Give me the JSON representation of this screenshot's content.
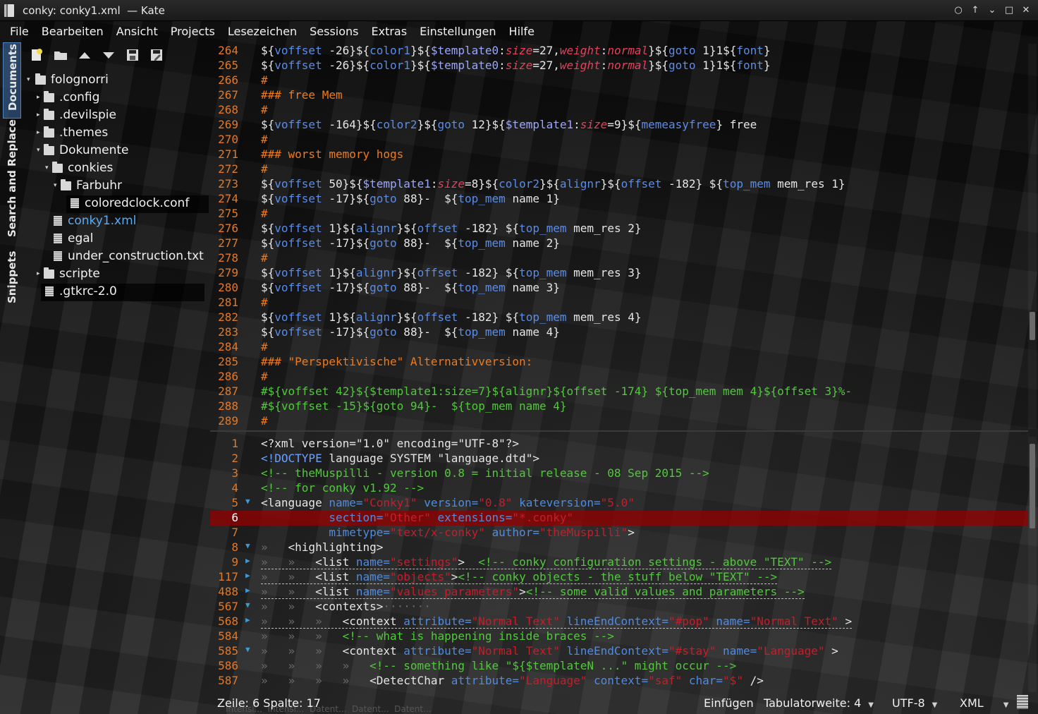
{
  "window": {
    "title": "conky: conky1.xml  — Kate",
    "buttons": [
      "○",
      "↑",
      "⌄",
      "□",
      "✕"
    ]
  },
  "menu": [
    {
      "label": "File"
    },
    {
      "label": "Bearbeiten"
    },
    {
      "label": "Ansicht"
    },
    {
      "label": "Projects"
    },
    {
      "label": "Lesezeichen"
    },
    {
      "label": "Sessions"
    },
    {
      "label": "Extras"
    },
    {
      "label": "Einstellungen"
    },
    {
      "label": "Hilfe"
    }
  ],
  "side_tabs": {
    "documents": "Documents",
    "search": "Search and Replace",
    "snippets": "Snippets"
  },
  "file_tree": [
    {
      "label": "folognorri",
      "type": "folder",
      "depth": 0,
      "arrow": "▾"
    },
    {
      "label": ".config",
      "type": "folder",
      "depth": 1,
      "arrow": "▸"
    },
    {
      "label": ".devilspie",
      "type": "folder",
      "depth": 1,
      "arrow": "▸"
    },
    {
      "label": ".themes",
      "type": "folder",
      "depth": 1,
      "arrow": "▸"
    },
    {
      "label": "Dokumente",
      "type": "folder",
      "depth": 1,
      "arrow": "▾"
    },
    {
      "label": "conkies",
      "type": "folder",
      "depth": 2,
      "arrow": "▾"
    },
    {
      "label": "Farbuhr",
      "type": "folder",
      "depth": 3,
      "arrow": "▾"
    },
    {
      "label": "coloredclock.conf",
      "type": "file",
      "depth": 4,
      "arrow": ""
    },
    {
      "label": "conky1.xml",
      "type": "file",
      "depth": 3,
      "arrow": "",
      "current": true
    },
    {
      "label": "egal",
      "type": "file",
      "depth": 3,
      "arrow": ""
    },
    {
      "label": "under_construction.txt",
      "type": "file",
      "depth": 3,
      "arrow": ""
    },
    {
      "label": "scripte",
      "type": "folder",
      "depth": 1,
      "arrow": "▸"
    },
    {
      "label": ".gtkrc-2.0",
      "type": "file",
      "depth": 1,
      "arrow": ""
    }
  ],
  "top_view": {
    "lines": [
      {
        "n": "264",
        "segs": [
          [
            "${",
            "def"
          ],
          [
            "voffset",
            "var"
          ],
          [
            " -26}${",
            "def"
          ],
          [
            "color1",
            "var"
          ],
          [
            "}${",
            "def"
          ],
          [
            "$template0",
            "tpl"
          ],
          [
            ":",
            "def"
          ],
          [
            "size",
            "kw"
          ],
          [
            "=27,",
            "def"
          ],
          [
            "weight",
            "kw"
          ],
          [
            ":",
            "def"
          ],
          [
            "normal",
            "kw"
          ],
          [
            "}${",
            "def"
          ],
          [
            "goto",
            "var"
          ],
          [
            " 1}1${",
            "def"
          ],
          [
            "font",
            "var"
          ],
          [
            "}",
            "def"
          ]
        ]
      },
      {
        "n": "265",
        "segs": [
          [
            "${",
            "def"
          ],
          [
            "voffset",
            "var"
          ],
          [
            " -26}${",
            "def"
          ],
          [
            "color1",
            "var"
          ],
          [
            "}${",
            "def"
          ],
          [
            "$template0",
            "tpl"
          ],
          [
            ":",
            "def"
          ],
          [
            "size",
            "kw"
          ],
          [
            "=27,",
            "def"
          ],
          [
            "weight",
            "kw"
          ],
          [
            ":",
            "def"
          ],
          [
            "normal",
            "kw"
          ],
          [
            "}${",
            "def"
          ],
          [
            "goto",
            "var"
          ],
          [
            " 1}1${",
            "def"
          ],
          [
            "font",
            "var"
          ],
          [
            "}",
            "def"
          ]
        ]
      },
      {
        "n": "266",
        "segs": [
          [
            "#",
            "com"
          ]
        ]
      },
      {
        "n": "267",
        "segs": [
          [
            "### free Mem",
            "com"
          ]
        ]
      },
      {
        "n": "268",
        "segs": [
          [
            "#",
            "com"
          ]
        ]
      },
      {
        "n": "269",
        "segs": [
          [
            "${",
            "def"
          ],
          [
            "voffset",
            "var"
          ],
          [
            " -164}${",
            "def"
          ],
          [
            "color2",
            "var"
          ],
          [
            "}${",
            "def"
          ],
          [
            "goto",
            "var"
          ],
          [
            " 12}${",
            "def"
          ],
          [
            "$template1",
            "tpl"
          ],
          [
            ":",
            "def"
          ],
          [
            "size",
            "kw"
          ],
          [
            "=9}${",
            "def"
          ],
          [
            "memeasyfree",
            "var"
          ],
          [
            "} free",
            "def"
          ]
        ]
      },
      {
        "n": "270",
        "segs": [
          [
            "#",
            "com"
          ]
        ]
      },
      {
        "n": "271",
        "segs": [
          [
            "### worst memory hogs",
            "com"
          ]
        ]
      },
      {
        "n": "272",
        "segs": [
          [
            "#",
            "com"
          ]
        ]
      },
      {
        "n": "273",
        "segs": [
          [
            "${",
            "def"
          ],
          [
            "voffset",
            "var"
          ],
          [
            " 50}${",
            "def"
          ],
          [
            "$template1",
            "tpl"
          ],
          [
            ":",
            "def"
          ],
          [
            "size",
            "kw"
          ],
          [
            "=8}${",
            "def"
          ],
          [
            "color2",
            "var"
          ],
          [
            "}${",
            "def"
          ],
          [
            "alignr",
            "var"
          ],
          [
            "}${",
            "def"
          ],
          [
            "offset",
            "var"
          ],
          [
            " -182} ${",
            "def"
          ],
          [
            "top_mem",
            "var"
          ],
          [
            " mem_res 1}",
            "def"
          ]
        ]
      },
      {
        "n": "274",
        "segs": [
          [
            "${",
            "def"
          ],
          [
            "voffset",
            "var"
          ],
          [
            " -17}${",
            "def"
          ],
          [
            "goto",
            "var"
          ],
          [
            " 88}-  ${",
            "def"
          ],
          [
            "top_mem",
            "var"
          ],
          [
            " name 1}",
            "def"
          ]
        ]
      },
      {
        "n": "275",
        "segs": [
          [
            "#",
            "com"
          ]
        ]
      },
      {
        "n": "276",
        "segs": [
          [
            "${",
            "def"
          ],
          [
            "voffset",
            "var"
          ],
          [
            " 1}${",
            "def"
          ],
          [
            "alignr",
            "var"
          ],
          [
            "}${",
            "def"
          ],
          [
            "offset",
            "var"
          ],
          [
            " -182} ${",
            "def"
          ],
          [
            "top_mem",
            "var"
          ],
          [
            " mem_res 2}",
            "def"
          ]
        ]
      },
      {
        "n": "277",
        "segs": [
          [
            "${",
            "def"
          ],
          [
            "voffset",
            "var"
          ],
          [
            " -17}${",
            "def"
          ],
          [
            "goto",
            "var"
          ],
          [
            " 88}-  ${",
            "def"
          ],
          [
            "top_mem",
            "var"
          ],
          [
            " name 2}",
            "def"
          ]
        ]
      },
      {
        "n": "278",
        "segs": [
          [
            "#",
            "com"
          ]
        ]
      },
      {
        "n": "279",
        "segs": [
          [
            "${",
            "def"
          ],
          [
            "voffset",
            "var"
          ],
          [
            " 1}${",
            "def"
          ],
          [
            "alignr",
            "var"
          ],
          [
            "}${",
            "def"
          ],
          [
            "offset",
            "var"
          ],
          [
            " -182} ${",
            "def"
          ],
          [
            "top_mem",
            "var"
          ],
          [
            " mem_res 3}",
            "def"
          ]
        ]
      },
      {
        "n": "280",
        "segs": [
          [
            "${",
            "def"
          ],
          [
            "voffset",
            "var"
          ],
          [
            " -17}${",
            "def"
          ],
          [
            "goto",
            "var"
          ],
          [
            " 88}-  ${",
            "def"
          ],
          [
            "top_mem",
            "var"
          ],
          [
            " name 3}",
            "def"
          ]
        ]
      },
      {
        "n": "281",
        "segs": [
          [
            "#",
            "com"
          ]
        ]
      },
      {
        "n": "282",
        "segs": [
          [
            "${",
            "def"
          ],
          [
            "voffset",
            "var"
          ],
          [
            " 1}${",
            "def"
          ],
          [
            "alignr",
            "var"
          ],
          [
            "}${",
            "def"
          ],
          [
            "offset",
            "var"
          ],
          [
            " -182} ${",
            "def"
          ],
          [
            "top_mem",
            "var"
          ],
          [
            " mem_res 4}",
            "def"
          ]
        ]
      },
      {
        "n": "283",
        "segs": [
          [
            "${",
            "def"
          ],
          [
            "voffset",
            "var"
          ],
          [
            " -17}${",
            "def"
          ],
          [
            "goto",
            "var"
          ],
          [
            " 88}-  ${",
            "def"
          ],
          [
            "top_mem",
            "var"
          ],
          [
            " name 4}",
            "def"
          ]
        ]
      },
      {
        "n": "284",
        "segs": [
          [
            "#",
            "com"
          ]
        ]
      },
      {
        "n": "285",
        "segs": [
          [
            "### \"Perspektivische\" Alternativversion:",
            "com"
          ]
        ]
      },
      {
        "n": "286",
        "segs": [
          [
            "#",
            "com"
          ]
        ]
      },
      {
        "n": "287",
        "segs": [
          [
            "#${voffset 42}${$template1:size=7}${alignr}${offset -174} ${top_mem mem 4}${offset 3}%-",
            "grn"
          ]
        ]
      },
      {
        "n": "288",
        "segs": [
          [
            "#${voffset -15}${goto 94}-  ${top_mem name 4}",
            "grn"
          ]
        ]
      },
      {
        "n": "289",
        "segs": [
          [
            "#",
            "com"
          ]
        ]
      }
    ]
  },
  "bottom_view": {
    "lines": [
      {
        "n": "1",
        "fold": "",
        "segs": [
          [
            "<?xml version=\"1.0\" encoding=\"UTF-8\"?>",
            "def"
          ]
        ]
      },
      {
        "n": "2",
        "fold": "",
        "segs": [
          [
            "<!DOCTYPE",
            "blu"
          ],
          [
            " language SYSTEM \"language.dtd\">",
            "def"
          ]
        ]
      },
      {
        "n": "3",
        "fold": "",
        "segs": [
          [
            "<!-- theMuspilli - version 0.8 = initial release - 08 Sep 2015 -->",
            "grn"
          ]
        ]
      },
      {
        "n": "4",
        "fold": "",
        "segs": [
          [
            "<!-- for conky v1.92 -->",
            "grn"
          ]
        ]
      },
      {
        "n": "5",
        "fold": "▼",
        "segs": [
          [
            "<language ",
            "def"
          ],
          [
            "name=",
            "attr"
          ],
          [
            "\"Conky1\"",
            "str"
          ],
          [
            " version=",
            "attr"
          ],
          [
            "\"0.8\"",
            "str"
          ],
          [
            " kateversion=",
            "attr"
          ],
          [
            "\"5.0\"",
            "str"
          ]
        ]
      },
      {
        "n": "6",
        "fold": "",
        "current": true,
        "segs": [
          [
            "          section=",
            "attr"
          ],
          [
            "\"Other\"",
            "str"
          ],
          [
            " extensions=",
            "attr"
          ],
          [
            "\"*.conky\"",
            "str"
          ]
        ]
      },
      {
        "n": "7",
        "fold": "",
        "segs": [
          [
            "          mimetype=",
            "attr"
          ],
          [
            "\"text/x-conky\"",
            "str"
          ],
          [
            " author=",
            "attr"
          ],
          [
            "\"theMuspilli\"",
            "str"
          ],
          [
            ">",
            "def"
          ]
        ]
      },
      {
        "n": "8",
        "fold": "▼",
        "segs": [
          [
            "»   ",
            "gry"
          ],
          [
            "<highlighting>",
            "def"
          ]
        ]
      },
      {
        "n": "9",
        "fold": "▶",
        "dotted": true,
        "segs": [
          [
            "»   »   ",
            "gry"
          ],
          [
            "<list ",
            "def"
          ],
          [
            "name=",
            "attr"
          ],
          [
            "\"settings\"",
            "str"
          ],
          [
            ">  ",
            "def"
          ],
          [
            "<!-- conky configuration settings - above \"TEXT\" -->",
            "grn"
          ]
        ]
      },
      {
        "n": "117",
        "fold": "▶",
        "dotted": true,
        "segs": [
          [
            "»   »   ",
            "gry"
          ],
          [
            "<list ",
            "def"
          ],
          [
            "name=",
            "attr"
          ],
          [
            "\"objects\"",
            "str"
          ],
          [
            ">",
            "def"
          ],
          [
            "<!-- conky objects - the stuff below \"TEXT\" -->",
            "grn"
          ]
        ]
      },
      {
        "n": "488",
        "fold": "▶",
        "dotted": true,
        "segs": [
          [
            "»   »   ",
            "gry"
          ],
          [
            "<list ",
            "def"
          ],
          [
            "name=",
            "attr"
          ],
          [
            "\"values_parameters\"",
            "str"
          ],
          [
            ">",
            "def"
          ],
          [
            "<!-- some valid values and parameters -->",
            "grn"
          ]
        ]
      },
      {
        "n": "567",
        "fold": "▼",
        "segs": [
          [
            "»   »   ",
            "gry"
          ],
          [
            "<contexts>",
            "def"
          ],
          [
            "·······",
            "gry"
          ]
        ]
      },
      {
        "n": "568",
        "fold": "▶",
        "dotted": true,
        "segs": [
          [
            "»   »   »   ",
            "gry"
          ],
          [
            "<context ",
            "def"
          ],
          [
            "attribute=",
            "attr"
          ],
          [
            "\"Normal Text\"",
            "str"
          ],
          [
            " lineEndContext=",
            "attr"
          ],
          [
            "\"#pop\"",
            "str"
          ],
          [
            " name=",
            "attr"
          ],
          [
            "\"Normal Text\"",
            "str"
          ],
          [
            " >",
            "def"
          ]
        ]
      },
      {
        "n": "584",
        "fold": "",
        "segs": [
          [
            "»   »   »   ",
            "gry"
          ],
          [
            "<!-- what is happening inside braces -->",
            "grn"
          ]
        ]
      },
      {
        "n": "585",
        "fold": "▼",
        "segs": [
          [
            "»   »   »   ",
            "gry"
          ],
          [
            "<context ",
            "def"
          ],
          [
            "attribute=",
            "attr"
          ],
          [
            "\"Normal Text\"",
            "str"
          ],
          [
            " lineEndContext=",
            "attr"
          ],
          [
            "\"#stay\"",
            "str"
          ],
          [
            " name=",
            "attr"
          ],
          [
            "\"Language\"",
            "str"
          ],
          [
            " >",
            "def"
          ]
        ]
      },
      {
        "n": "586",
        "fold": "",
        "segs": [
          [
            "»   »   »   »   ",
            "gry"
          ],
          [
            "<!-- something like \"${$templateN ...\" might occur -->",
            "grn"
          ]
        ]
      },
      {
        "n": "587",
        "fold": "",
        "segs": [
          [
            "»   »   »   »   ",
            "gry"
          ],
          [
            "<DetectChar ",
            "def"
          ],
          [
            "attribute=",
            "attr"
          ],
          [
            "\"Language\"",
            "str"
          ],
          [
            " context=",
            "attr"
          ],
          [
            "\"saf\"",
            "str"
          ],
          [
            " char=",
            "attr"
          ],
          [
            "\"$\"",
            "str"
          ],
          [
            " />",
            "def"
          ]
        ]
      }
    ]
  },
  "status": {
    "position": "Zeile: 6 Spalte: 17",
    "mode": "Einfügen",
    "tab_width": "Tabulatorweite: 4",
    "encoding": "UTF-8",
    "syntax": "XML",
    "ghost_tabs": "Intensi...  Intensi...  Datent...  Datent...  Datent..."
  },
  "colors": {
    "line_number": "#e07a2a",
    "variable": "#5a8ce8",
    "keyword": "#e8405a",
    "comment": "#ef7a1a",
    "xml_comment": "#52c83c",
    "string": "#c41e2a",
    "current_line": "#960000",
    "selection_blue": "#5aa9f5"
  }
}
